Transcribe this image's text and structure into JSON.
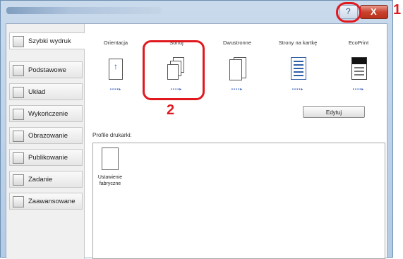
{
  "sidebar": {
    "items": [
      {
        "label": "Szybki wydruk",
        "icon": "quick-print-icon"
      },
      {
        "label": "Podstawowe",
        "icon": "basic-icon"
      },
      {
        "label": "Układ",
        "icon": "layout-icon"
      },
      {
        "label": "Wykończenie",
        "icon": "finishing-icon"
      },
      {
        "label": "Obrazowanie",
        "icon": "imaging-icon"
      },
      {
        "label": "Publikowanie",
        "icon": "publishing-icon"
      },
      {
        "label": "Zadanie",
        "icon": "job-icon"
      },
      {
        "label": "Zaawansowane",
        "icon": "advanced-icon"
      }
    ]
  },
  "features": [
    {
      "label": "Orientacja",
      "icon": "orientation-icon"
    },
    {
      "label": "Sortuj",
      "icon": "collate-icon"
    },
    {
      "label": "Dwustronne",
      "icon": "duplex-icon"
    },
    {
      "label": "Strony na kartkę",
      "icon": "pages-per-sheet-icon"
    },
    {
      "label": "EcoPrint",
      "icon": "ecoprint-icon"
    }
  ],
  "dots": "▪▪▪▪▸",
  "edit_button": "Edytuj",
  "profiles": {
    "label": "Profile drukarki:",
    "items": [
      {
        "label": "Ustawienie fabryczne"
      }
    ]
  },
  "window": {
    "help_label": "?",
    "close_label": "X"
  },
  "callouts": {
    "one": "1",
    "two": "2"
  },
  "colors": {
    "callout": "#e0191f",
    "accent": "#2f5fa6"
  }
}
